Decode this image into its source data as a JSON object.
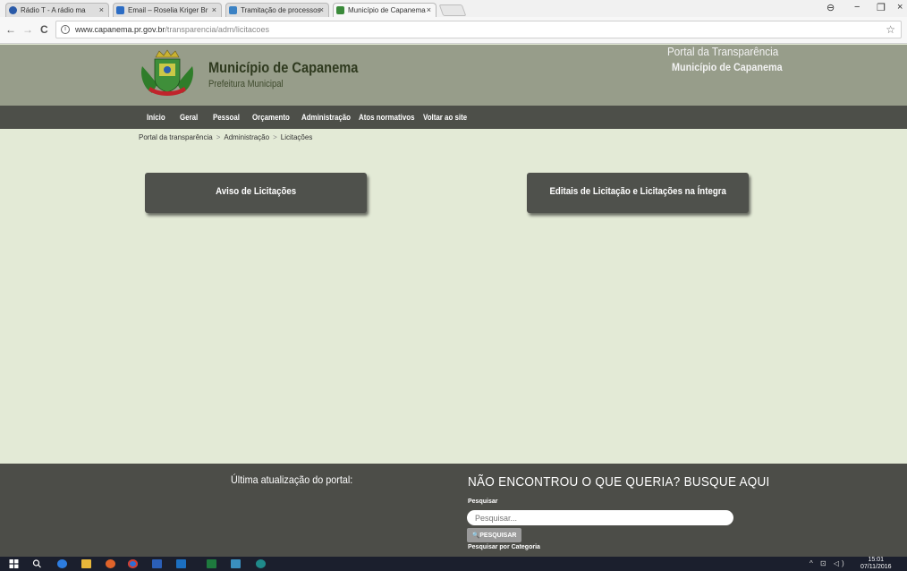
{
  "browser": {
    "tabs": [
      {
        "title": "Rádio T - A rádio ma",
        "favicon_color": "#2a5aa8",
        "active": false
      },
      {
        "title": "Email – Roselia Kriger Br",
        "favicon_color": "#2b6cc4",
        "active": false
      },
      {
        "title": "Tramitação de processos",
        "favicon_color": "#3b82c4",
        "active": false
      },
      {
        "title": "Município de Capanema",
        "favicon_color": "#3a8a3a",
        "active": true
      }
    ],
    "tab_close_glyph": "×",
    "url_host": "www.capanema.pr.gov.br",
    "url_path": "/transparencia/adm/licitacoes",
    "back_glyph": "←",
    "forward_glyph": "→",
    "reload_glyph": "C",
    "info_glyph": "i",
    "bookmark_glyph": "☆",
    "window_controls": {
      "profile": "⊖",
      "minimize": "−",
      "restore": "❐",
      "close": "×"
    }
  },
  "header": {
    "title": "Município de Capanema",
    "subtitle": "Prefeitura Municipal",
    "portal_title": "Portal da Transparência",
    "portal_subtitle": "Município de Capanema"
  },
  "nav": {
    "items": [
      "Início",
      "Geral",
      "Pessoal",
      "Orçamento",
      "Administração",
      "Atos normativos",
      "Voltar ao site"
    ]
  },
  "breadcrumb": {
    "items": [
      "Portal da transparência",
      "Administração",
      "Licitações"
    ],
    "separator": ">"
  },
  "cards": [
    {
      "label": "Aviso de Licitações"
    },
    {
      "label": "Editais de Licitação e Licitações na Íntegra"
    }
  ],
  "footer": {
    "update_label": "Última atualização do portal:",
    "search_heading": "NÃO ENCONTROU O QUE QUERIA? BUSQUE AQUI",
    "search_label": "Pesquisar",
    "search_placeholder": "Pesquisar...",
    "search_button": "🔍PESQUISAR",
    "category_label": "Pesquisar por Categoria"
  },
  "taskbar": {
    "time": "15:01",
    "date": "07/11/2016",
    "tray_glyphs": "^ ⊡ ◁)"
  },
  "colors": {
    "page_bg": "#e3ead6",
    "header_bg": "#979d8a",
    "nav_bg": "#4d4f49",
    "card_bg": "#4f514c",
    "footer_bg": "#4c4d48"
  }
}
